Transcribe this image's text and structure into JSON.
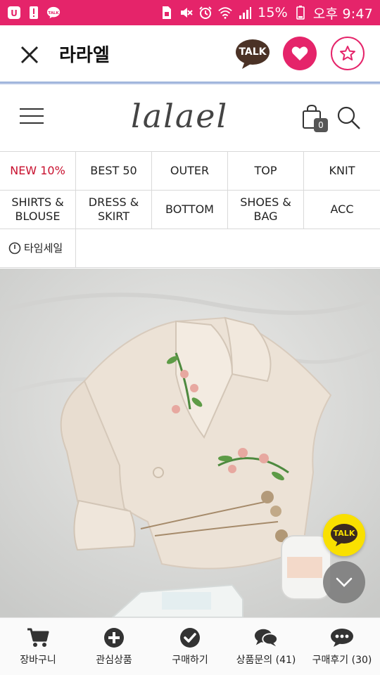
{
  "status_bar": {
    "battery": "15%",
    "time": "오후 9:47",
    "bg_color": "#e5246a",
    "icons": [
      "u-plus-icon",
      "alert-icon",
      "talk-icon",
      "usim-icon",
      "mute-icon",
      "alarm-icon",
      "wifi-icon",
      "signal-icon",
      "battery-icon"
    ]
  },
  "app_header": {
    "title": "라라엘",
    "talk_label": "TALK",
    "accent": "#e5246a"
  },
  "site_header": {
    "logo": "lalael",
    "cart_count": "0"
  },
  "categories": {
    "row1": [
      "NEW 10%",
      "BEST 50",
      "OUTER",
      "TOP",
      "KNIT"
    ],
    "row2": [
      "SHIRTS &\nBLOUSE",
      "DRESS &\nSKIRT",
      "BOTTOM",
      "SHOES &\nBAG",
      "ACC"
    ],
    "time_sale": "타임세일",
    "highlight_color": "#c8102e"
  },
  "fab": {
    "talk_label": "TALK"
  },
  "bottom_nav": {
    "cart": "장바구니",
    "wishlist": "관심상품",
    "buy": "구매하기",
    "qna": "상품문의 (41)",
    "review": "구매후기 (30)"
  }
}
